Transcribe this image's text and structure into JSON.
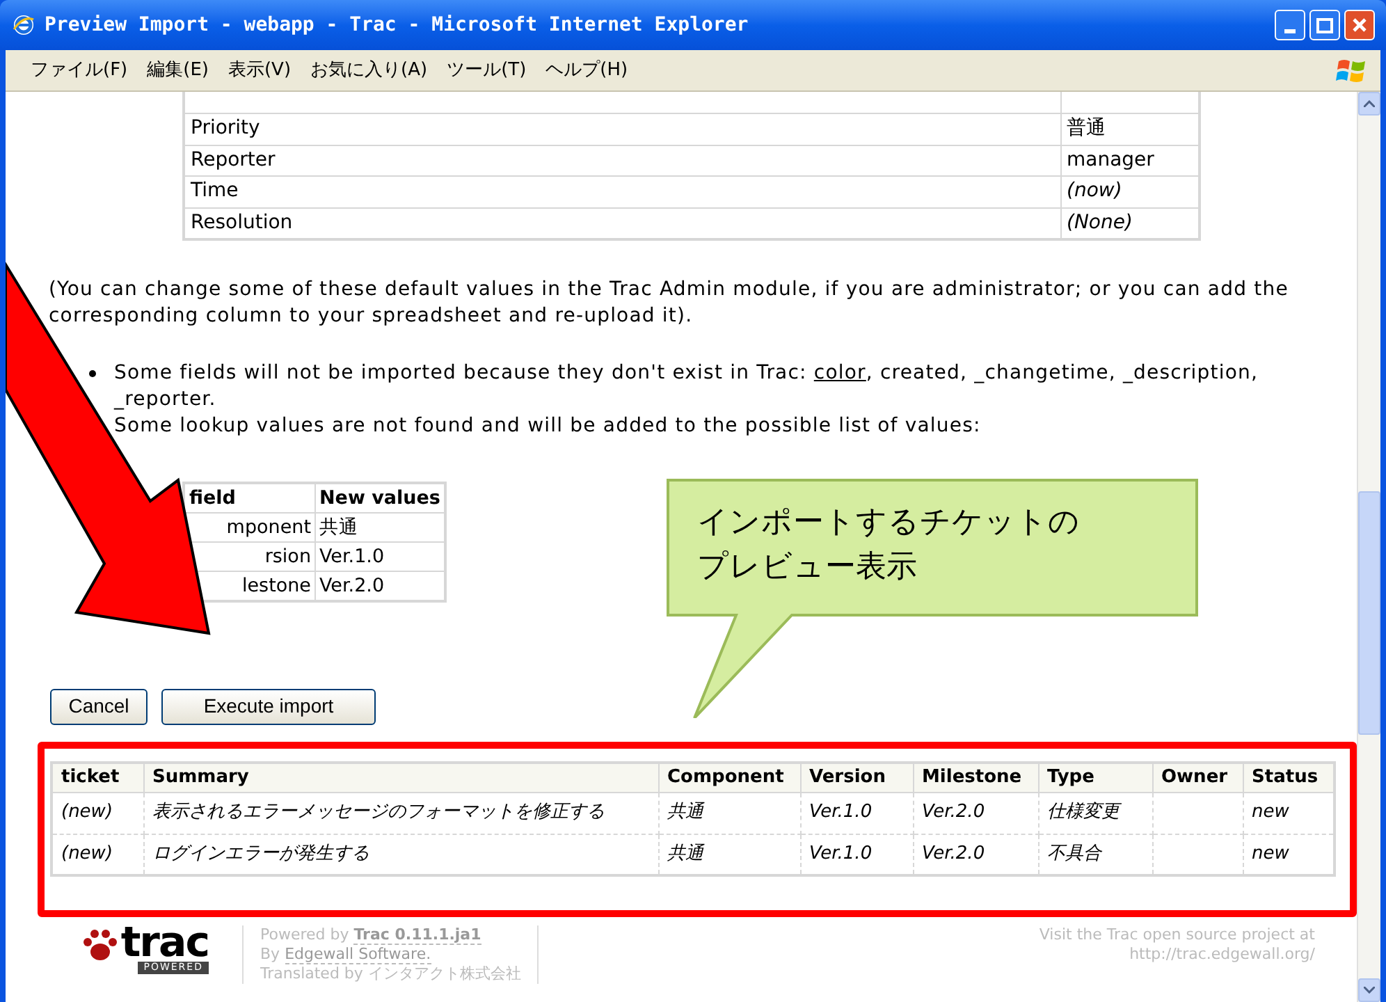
{
  "window": {
    "title": "Preview Import - webapp - Trac - Microsoft Internet Explorer"
  },
  "menu": [
    "ファイル(F)",
    "編集(E)",
    "表示(V)",
    "お気に入り(A)",
    "ツール(T)",
    "ヘルプ(H)"
  ],
  "defaults_table": {
    "rows": [
      {
        "field": "Priority",
        "value": "普通",
        "italic": false
      },
      {
        "field": "Reporter",
        "value": "manager",
        "italic": false
      },
      {
        "field": "Time",
        "value": "(now)",
        "italic": true
      },
      {
        "field": "Resolution",
        "value": "(None)",
        "italic": true
      }
    ]
  },
  "note": "(You can change some of these default values in the Trac Admin module, if you are administrator; or you can add the corresponding column to your spreadsheet and re-upload it).",
  "bullet": {
    "prefix": "Some fields will not be imported because they don't exist in Trac: ",
    "link": "color",
    "suffix": ", created, _changetime, _description, _reporter.",
    "followup": "Some lookup values are not found and will be added to the possible list of values:"
  },
  "lookup_table": {
    "columns": [
      "field",
      "New values"
    ],
    "rows": [
      {
        "field": "mponent",
        "value": "共通"
      },
      {
        "field": "rsion",
        "value": "Ver.1.0"
      },
      {
        "field": "lestone",
        "value": "Ver.2.0"
      }
    ]
  },
  "buttons": [
    "Cancel",
    "Execute import"
  ],
  "preview_table": {
    "columns": [
      "ticket",
      "Summary",
      "Component",
      "Version",
      "Milestone",
      "Type",
      "Owner",
      "Status"
    ],
    "rows": [
      [
        "(new)",
        "表示されるエラーメッセージのフォーマットを修正する",
        "共通",
        "Ver.1.0",
        "Ver.2.0",
        "仕様変更",
        "",
        "new"
      ],
      [
        "(new)",
        "ログインエラーが発生する",
        "共通",
        "Ver.1.0",
        "Ver.2.0",
        "不具合",
        "",
        "new"
      ]
    ]
  },
  "callout": [
    "インポートするチケットの",
    "プレビュー表示"
  ],
  "footer": {
    "logo": "trac",
    "logo_badge": "POWERED",
    "powered_prefix": "Powered by ",
    "powered_link": "Trac 0.11.1.ja1",
    "by_prefix": "By ",
    "by_link": "Edgewall Software.",
    "translated": "Translated by インタアクト株式会社",
    "visit": "Visit the Trac open source project at",
    "url": "http://trac.edgewall.org/"
  }
}
